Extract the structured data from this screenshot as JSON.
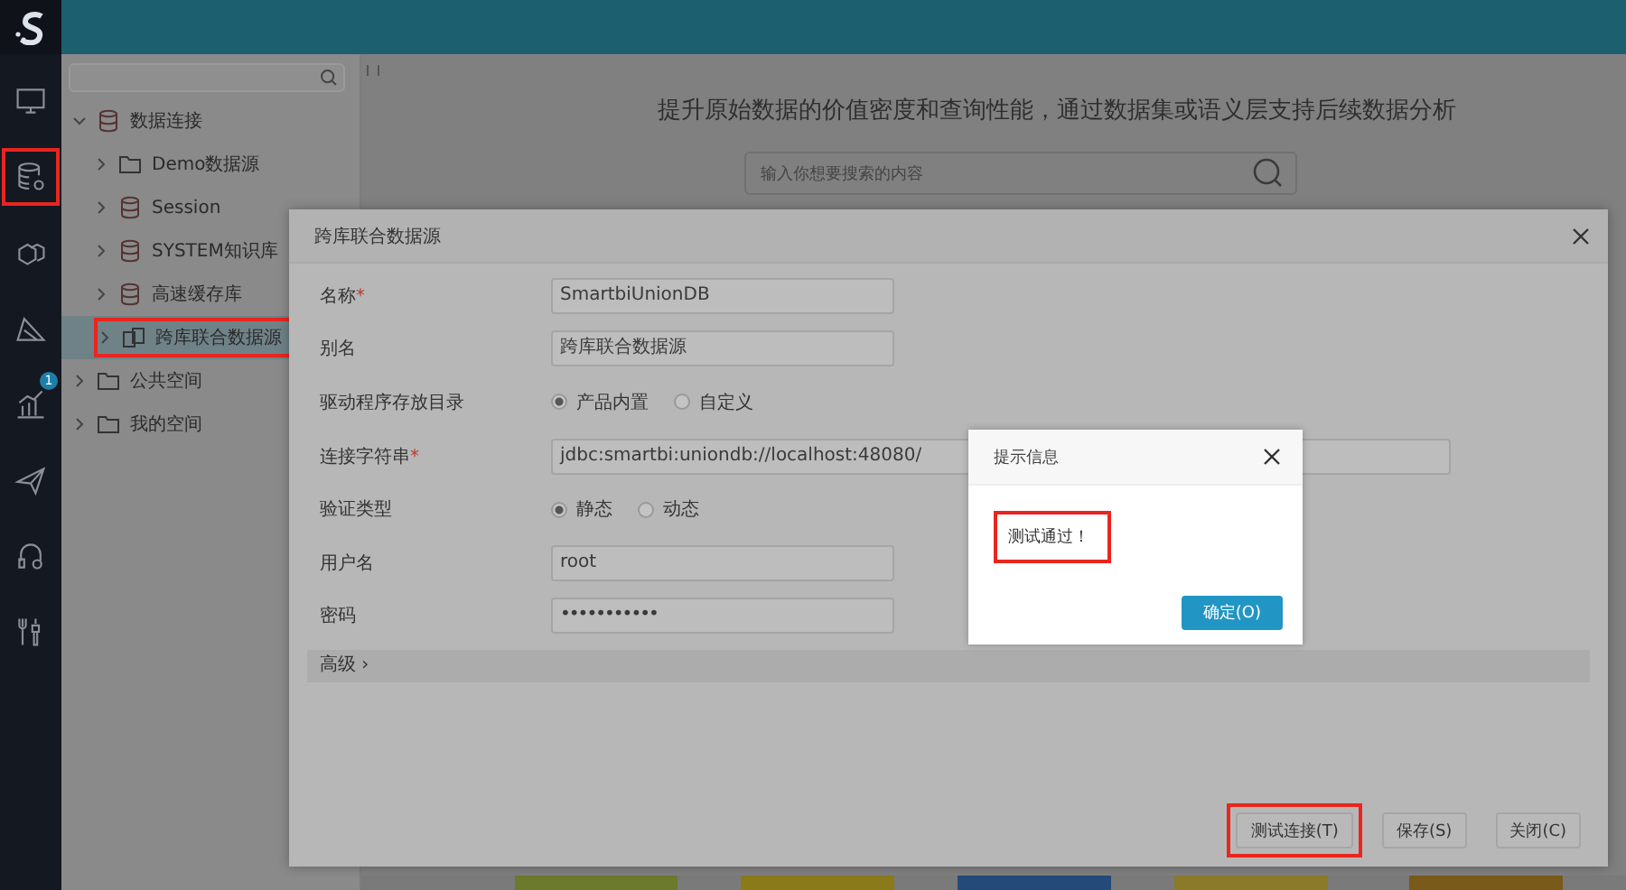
{
  "nav": {
    "items": [
      {
        "highlighted": false
      },
      {
        "highlighted": true
      },
      {
        "highlighted": false
      },
      {
        "highlighted": false
      },
      {
        "highlighted": false,
        "badge": "1"
      },
      {
        "highlighted": false
      },
      {
        "highlighted": false
      },
      {
        "highlighted": false
      }
    ]
  },
  "sidebar": {
    "tree": [
      {
        "label": "数据连接",
        "kind": "database",
        "expanded": true,
        "selected": false,
        "highlighted": false,
        "children": [
          {
            "label": "Demo数据源",
            "kind": "folder",
            "expanded": false,
            "selected": false,
            "highlighted": false
          },
          {
            "label": "Session",
            "kind": "database",
            "expanded": false,
            "selected": false,
            "highlighted": false
          },
          {
            "label": "SYSTEM知识库",
            "kind": "database",
            "expanded": false,
            "selected": false,
            "highlighted": false
          },
          {
            "label": "高速缓存库",
            "kind": "database",
            "expanded": false,
            "selected": false,
            "highlighted": false
          },
          {
            "label": "跨库联合数据源",
            "kind": "linked",
            "expanded": false,
            "selected": true,
            "highlighted": true
          }
        ]
      },
      {
        "label": "公共空间",
        "kind": "folder",
        "expanded": false,
        "selected": false,
        "highlighted": false
      },
      {
        "label": "我的空间",
        "kind": "folder",
        "expanded": false,
        "selected": false,
        "highlighted": false
      }
    ]
  },
  "main": {
    "headline": "提升原始数据的价值密度和查询性能，通过数据集或语义层支持后续数据分析",
    "search": {
      "placeholder": "输入你想要搜索的内容"
    }
  },
  "dialog": {
    "title": "跨库联合数据源",
    "fields": [
      {
        "kind": "text",
        "label": "名称",
        "marker": "*",
        "value": "SmartbiUnionDB"
      },
      {
        "kind": "text",
        "label": "别名",
        "value": "跨库联合数据源"
      },
      {
        "kind": "radio",
        "label": "驱动程序存放目录",
        "options": [
          {
            "label": "产品内置",
            "selected": true
          },
          {
            "label": "自定义",
            "selected": false
          }
        ]
      },
      {
        "kind": "longtext",
        "label": "连接字符串",
        "marker": "*",
        "value": "jdbc:smartbi:uniondb://localhost:48080/"
      },
      {
        "kind": "radio",
        "label": "验证类型",
        "options": [
          {
            "label": "静态",
            "selected": true
          },
          {
            "label": "动态",
            "selected": false
          }
        ]
      },
      {
        "kind": "text",
        "label": "用户名",
        "value": "root"
      },
      {
        "kind": "password",
        "label": "密码",
        "value": "•••••••••••"
      }
    ],
    "advanced": "高级 ›",
    "buttons": [
      {
        "label": "测试连接(T)",
        "highlighted": true
      },
      {
        "label": "保存(S)",
        "highlighted": false
      },
      {
        "label": "关闭(C)",
        "highlighted": false
      }
    ]
  },
  "alert": {
    "title": "提示信息",
    "message": "测试通过！",
    "message_highlighted": true,
    "button": "确定(O)"
  }
}
